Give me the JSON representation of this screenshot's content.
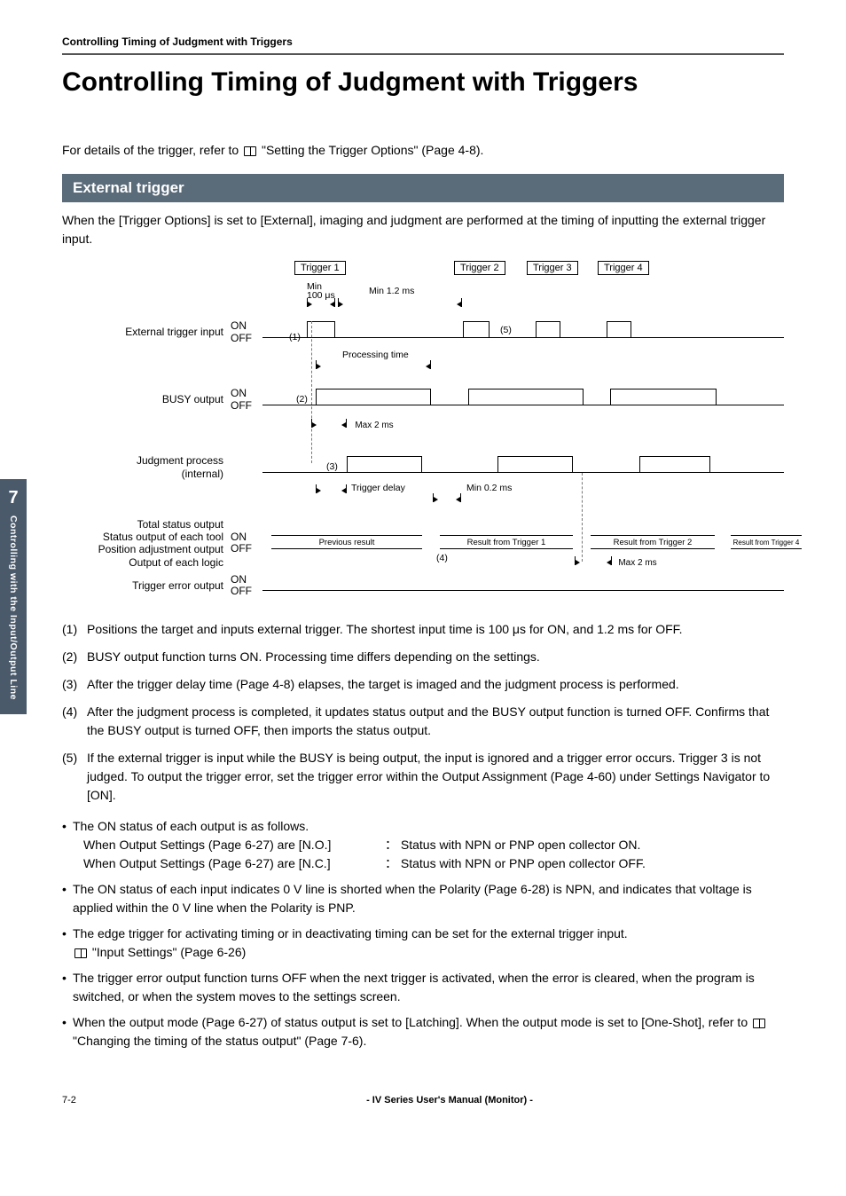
{
  "running_head": "Controlling Timing of Judgment with Triggers",
  "page_title": "Controlling Timing of Judgment with Triggers",
  "intro_prefix": "For details of the trigger, refer to ",
  "intro_link": "\"Setting the Trigger Options\" (Page 4-8).",
  "section": {
    "heading": "External trigger",
    "intro": "When the [Trigger Options] is set to [External], imaging and judgment are performed at the timing of inputting the external trigger input."
  },
  "diagram": {
    "triggers": [
      "Trigger 1",
      "Trigger 2",
      "Trigger 3",
      "Trigger 4"
    ],
    "time_min_on": "Min\n100 μs",
    "time_min_off": "Min 1.2 ms",
    "processing_time": "Processing time",
    "max2ms_a": "Max 2 ms",
    "trigger_delay": "Trigger delay",
    "min02": "Min 0.2 ms",
    "max2ms_b": "Max 2 ms",
    "prev_result": "Previous result",
    "res1": "Result from Trigger 1",
    "res2": "Result from Trigger 2",
    "res4": "Result from Trigger 4",
    "signals": {
      "ext": "External trigger input",
      "busy": "BUSY output",
      "judge": "Judgment process\n(internal)",
      "status": "Total status output\nStatus output of each tool\nPosition adjustment output\nOutput of each logic",
      "terr": "Trigger error output"
    },
    "on": "ON",
    "off": "OFF",
    "callouts": {
      "c1": "(1)",
      "c2": "(2)",
      "c3": "(3)",
      "c4": "(4)",
      "c5": "(5)"
    }
  },
  "numbered": [
    "Positions the target and inputs external trigger. The shortest input time is 100 μs for ON, and 1.2 ms for OFF.",
    "BUSY output function turns ON. Processing time differs depending on the settings.",
    "After the trigger delay time (Page 4-8) elapses, the target is imaged and the judgment process is performed.",
    "After the judgment process is completed, it updates status output and the BUSY output function is turned OFF. Confirms that the BUSY output is turned OFF, then imports the status output.",
    "If the external trigger is input while the BUSY is being output, the input is ignored and a trigger error occurs. Trigger 3 is not judged. To output the trigger error, set the trigger error within the Output Assignment (Page 4-60) under Settings Navigator to [ON]."
  ],
  "bullets": {
    "b1_lead": "The ON status of each output is as follows.",
    "b1_row1_lhs": "When Output Settings (Page 6-27) are [N.O.]",
    "b1_row1_rhs": "： Status with NPN or PNP open collector ON.",
    "b1_row2_lhs": "When Output Settings (Page 6-27) are [N.C.]",
    "b1_row2_rhs": "： Status with NPN or PNP open collector OFF.",
    "b2": "The ON status of each input indicates 0 V line is shorted when the Polarity (Page 6-28) is NPN, and indicates that voltage is applied within the 0 V line when the Polarity is PNP.",
    "b3": "The edge trigger for activating timing or in deactivating timing can be set for the external trigger input.",
    "b3_ref": "\"Input Settings\" (Page 6-26)",
    "b4": "The trigger error output function turns OFF when the next trigger is activated, when the error is cleared, when the program is switched, or when the system moves to the settings screen.",
    "b5_pre": "When the output mode (Page 6-27) of status output is set to [Latching]. When the output mode is set to [One-Shot], refer to ",
    "b5_ref": "\"Changing the timing of the status output\" (Page 7-6)."
  },
  "sidebar": {
    "chapter": "7",
    "label": "Controlling with the Input/Output Line"
  },
  "footer": {
    "page": "7-2",
    "title": "- IV Series User's Manual (Monitor) -"
  }
}
